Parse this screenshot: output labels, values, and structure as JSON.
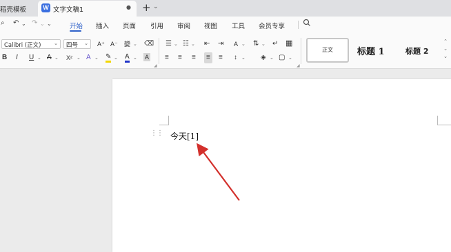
{
  "tabs": {
    "inactive_label": "稻壳模板",
    "active_label": "文字文稿1",
    "active_logo": "W",
    "unsaved_dot": "●",
    "new_tab": "+",
    "new_tab_dropdown": "⌄"
  },
  "quick_access": {
    "search_doc": "⌕",
    "undo": "↶",
    "undo_drop": "⌄",
    "redo": "↷",
    "redo_drop": "⌄",
    "more": "⌄"
  },
  "menu": {
    "items": [
      "开始",
      "插入",
      "页面",
      "引用",
      "审阅",
      "视图",
      "工具",
      "会员专享"
    ],
    "active_index": 0,
    "accent_color": "#2f61c9"
  },
  "ribbon": {
    "font_name": "Calibri (正文)",
    "font_size": "四号",
    "grow_font": "A⁺",
    "shrink_font": "A⁻",
    "pinyin": "變",
    "clear_format": "⌫",
    "bold": "B",
    "italic": "I",
    "underline": "U",
    "strikethrough": "A",
    "superscript": "X²",
    "text_effect": "A",
    "highlight": "✎",
    "font_color": "A",
    "char_shading": "A",
    "bullets": "☰",
    "numbering": "☷",
    "decrease_indent": "⇤",
    "increase_indent": "⇥",
    "text_direction": "A",
    "sort": "⇅",
    "show_marks": "↵",
    "align_left": "≡",
    "align_center": "≡",
    "align_right": "≡",
    "justify": "≡",
    "distributed": "≡",
    "line_spacing": "↕",
    "shading": "◈",
    "borders": "▢",
    "dropdown": "⌄"
  },
  "styles": {
    "normal": "正文",
    "heading1": "标题 1",
    "heading2": "标题 2",
    "scroll_up": "⌃",
    "scroll_down": "⌄",
    "more": "⌄"
  },
  "document": {
    "drag_handle": "⋮⋮",
    "text": "今天[1]"
  },
  "annotation": {
    "arrow_color": "#d3302c"
  }
}
